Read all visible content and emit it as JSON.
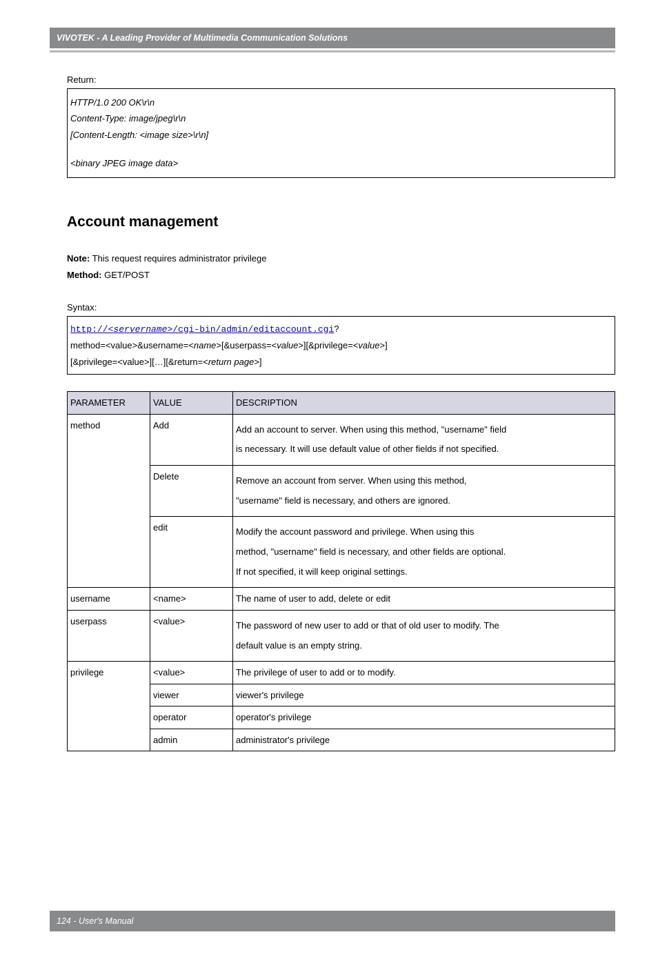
{
  "header": {
    "title": "VIVOTEK - A Leading Provider of Multimedia Communication Solutions"
  },
  "return_label": "Return:",
  "http_box": {
    "line1": "HTTP/1.0 200 OK\\r\\n",
    "line2": "Content-Type: image/jpeg\\r\\n",
    "line3": "[Content-Length: <image size>\\r\\n]",
    "line4": "<binary JPEG image data>"
  },
  "section_title": "Account management",
  "note_label": "Note:",
  "note_text": " This request requires administrator privilege",
  "method_label": "Method:",
  "method_text": " GET/POST",
  "syntax_label": "Syntax:",
  "syntax_box": {
    "url_prefix": "http://<",
    "url_server": "servername",
    "url_suffix": ">/cgi-bin/admin/editaccount.cgi",
    "qmark": "?",
    "line2_a": "method=<value>&username=<",
    "line2_b": "name",
    "line2_c": ">[&userpass=<",
    "line2_d": "value",
    "line2_e": ">][&privilege=<",
    "line2_f": "value",
    "line2_g": ">]",
    "line3_a": "[&privilege=<value>][…][&return=<",
    "line3_b": "return page",
    "line3_c": ">]"
  },
  "table": {
    "headers": {
      "param": "PARAMETER",
      "value": "VALUE",
      "desc": "DESCRIPTION"
    },
    "rows": {
      "method_add": {
        "param": "method",
        "value": "Add",
        "desc1": "Add an account to server. When using this method, \"username\" field",
        "desc2": "is necessary. It will use default value of other fields if not specified."
      },
      "method_delete": {
        "value": "Delete",
        "desc1": "Remove an account from server. When using this method,",
        "desc2": "\"username\" field is necessary, and others are ignored."
      },
      "method_edit": {
        "value": "edit",
        "desc1": "Modify the account password and privilege. When using this",
        "desc2": "method, \"username\" field is necessary, and other fields are optional.",
        "desc3": "If not specified, it will keep original settings."
      },
      "username": {
        "param": "username",
        "value": "<name>",
        "desc": "The name of user to add, delete or edit"
      },
      "userpass": {
        "param": "userpass",
        "value": "<value>",
        "desc1": "The password of new user to add or that of old user to modify. The",
        "desc2": "default value is an empty string."
      },
      "privilege": {
        "param": "privilege",
        "value": "<value>",
        "desc": "The privilege of user to add or to modify."
      },
      "viewer": {
        "value": "viewer",
        "desc": "viewer's privilege"
      },
      "operator": {
        "value": "operator",
        "desc": "operator's privilege"
      },
      "admin": {
        "value": "admin",
        "desc": "administrator's privilege"
      }
    }
  },
  "footer": {
    "text": "124 - User's Manual"
  }
}
